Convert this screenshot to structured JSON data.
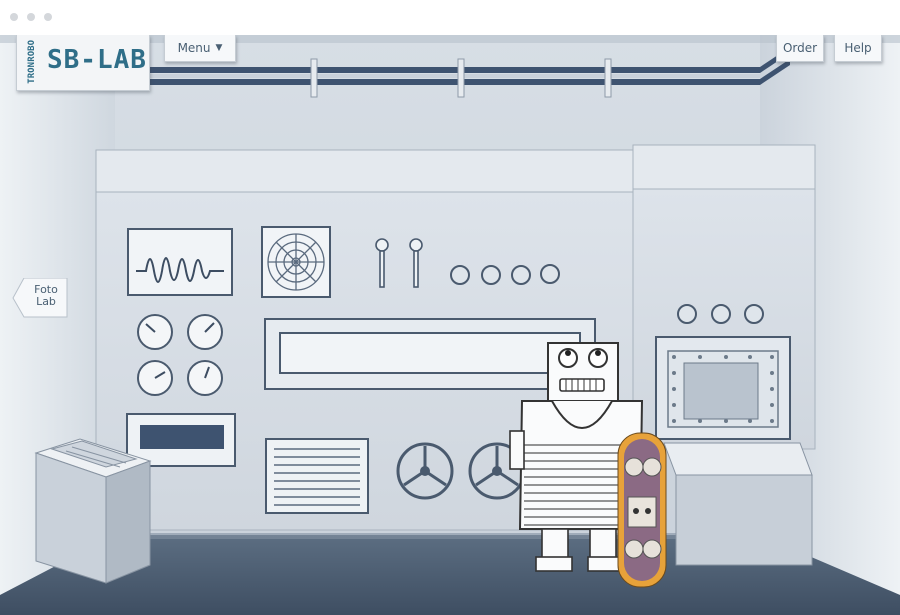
{
  "app": {
    "logo_small_top": "ROBO",
    "logo_small_bottom": "TRON",
    "logo_main": "SB-LAB"
  },
  "nav": {
    "menu_label": "Menu",
    "menu_caret": "▼",
    "order_label": "Order",
    "help_label": "Help"
  },
  "side_link": {
    "line1": "Foto",
    "line2": "Lab"
  },
  "colors": {
    "wall": "#dde3e9",
    "floor": "#4d5f74",
    "accent": "#2f6e88",
    "pipe": "#3e5370",
    "chrome": "#ffffff"
  },
  "icons": {
    "menu_caret": "caret-down-icon",
    "side_link_arrow": "arrow-left-icon"
  }
}
